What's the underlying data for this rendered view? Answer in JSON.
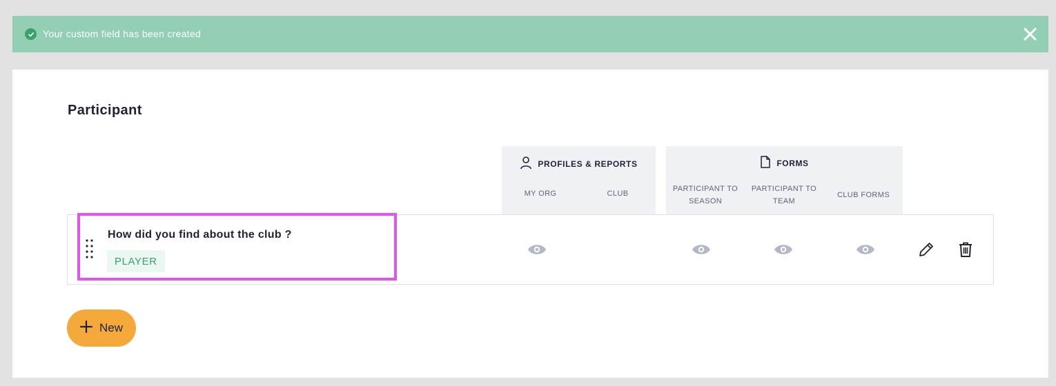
{
  "banner": {
    "message": "Your custom field has been created",
    "icon": "check-circle-icon",
    "close_icon": "close-icon",
    "color": "#92cfb5"
  },
  "section": {
    "title": "Participant"
  },
  "column_groups": [
    {
      "label": "PROFILES & REPORTS",
      "icon": "person-icon",
      "columns": [
        "MY ORG",
        "CLUB"
      ]
    },
    {
      "label": "FORMS",
      "icon": "document-icon",
      "columns": [
        "PARTICIPANT TO SEASON",
        "PARTICIPANT TO TEAM",
        "CLUB FORMS"
      ]
    }
  ],
  "fields": [
    {
      "title": "How did you find about the club ?",
      "tag": "PLAYER",
      "visibility": {
        "my_org": true,
        "club": false,
        "participant_to_season": true,
        "participant_to_team": true,
        "club_forms": true
      },
      "actions": [
        "edit-icon",
        "trash-icon"
      ]
    }
  ],
  "new_button": {
    "label": "New",
    "icon": "plus-icon",
    "color": "#f4a93a"
  },
  "colors": {
    "highlight": "#e453ef",
    "tag_text": "#3da06c",
    "tag_bg": "#eaf8f1"
  }
}
